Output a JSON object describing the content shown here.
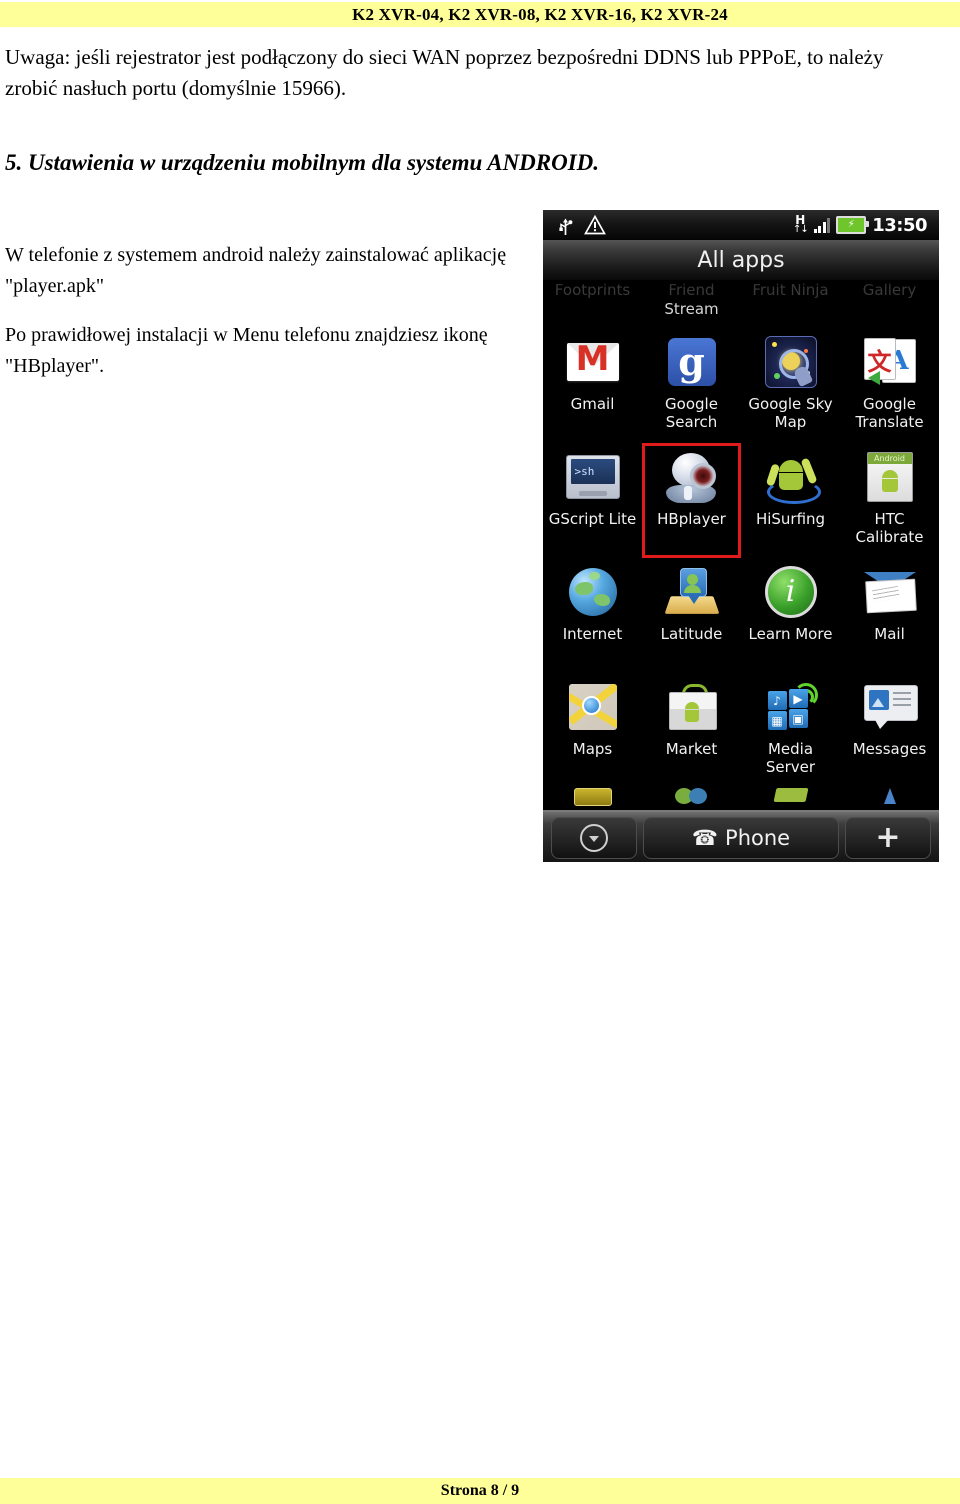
{
  "header": {
    "title": "K2 XVR-04, K2 XVR-08, K2 XVR-16, K2 XVR-24",
    "band_color": "#ffff99"
  },
  "footer": {
    "page_label": "Strona 8 / 9",
    "band_color": "#ffff99"
  },
  "document": {
    "note": "Uwaga: jeśli rejestrator jest podłączony do sieci WAN poprzez bezpośredni DDNS lub PPPoE,  to należy  zrobić nasłuch portu (domyślnie 15966).",
    "section_heading": "5. Ustawienia w urządzeniu mobilnym dla systemu ANDROID.",
    "paragraph_1": "W telefonie z systemem android należy zainstalować aplikację \"player.apk\"",
    "paragraph_2": "Po prawidłowej instalacji w Menu telefonu znajdziesz ikonę \"HBplayer\"."
  },
  "phone": {
    "status_bar": {
      "usb_icon": "usb-icon",
      "warning_icon": "warning-triangle-icon",
      "network_type": "H",
      "network_arrows": "↑↓",
      "signal_icon": "signal-bars-icon",
      "battery_icon": "battery-charging-icon",
      "clock": "13:50"
    },
    "title": "All apps",
    "faded_row": [
      {
        "label": "Footprints",
        "second_line": ""
      },
      {
        "label": "Friend",
        "second_line": "Stream"
      },
      {
        "label": "Fruit Ninja",
        "second_line": ""
      },
      {
        "label": "Gallery",
        "second_line": ""
      }
    ],
    "app_rows": [
      [
        {
          "label": "Gmail",
          "icon": "gmail-icon",
          "highlighted": false
        },
        {
          "label": "Google\nSearch",
          "icon": "google-search-icon",
          "highlighted": false
        },
        {
          "label": "Google Sky\nMap",
          "icon": "google-sky-map-icon",
          "highlighted": false
        },
        {
          "label": "Google\nTranslate",
          "icon": "google-translate-icon",
          "highlighted": false
        }
      ],
      [
        {
          "label": "GScript Lite",
          "icon": "gscript-lite-icon",
          "highlighted": false
        },
        {
          "label": "HBplayer",
          "icon": "hbplayer-icon",
          "highlighted": true
        },
        {
          "label": "HiSurfing",
          "icon": "hisurfing-icon",
          "highlighted": false
        },
        {
          "label": "HTC\nCalibrate",
          "icon": "htc-calibrate-icon",
          "highlighted": false
        }
      ],
      [
        {
          "label": "Internet",
          "icon": "internet-icon",
          "highlighted": false
        },
        {
          "label": "Latitude",
          "icon": "latitude-icon",
          "highlighted": false
        },
        {
          "label": "Learn More",
          "icon": "learn-more-icon",
          "highlighted": false
        },
        {
          "label": "Mail",
          "icon": "mail-icon",
          "highlighted": false
        }
      ],
      [
        {
          "label": "Maps",
          "icon": "maps-icon",
          "highlighted": false
        },
        {
          "label": "Market",
          "icon": "market-icon",
          "highlighted": false
        },
        {
          "label": "Media\nServer",
          "icon": "media-server-icon",
          "highlighted": false
        },
        {
          "label": "Messages",
          "icon": "messages-icon",
          "highlighted": false
        }
      ]
    ],
    "dock": {
      "collapse_icon": "circle-chevron-down-icon",
      "phone_label": "Phone",
      "phone_icon": "phone-handset-icon",
      "add_label": "+"
    },
    "highlight_color": "#e01b1b"
  }
}
